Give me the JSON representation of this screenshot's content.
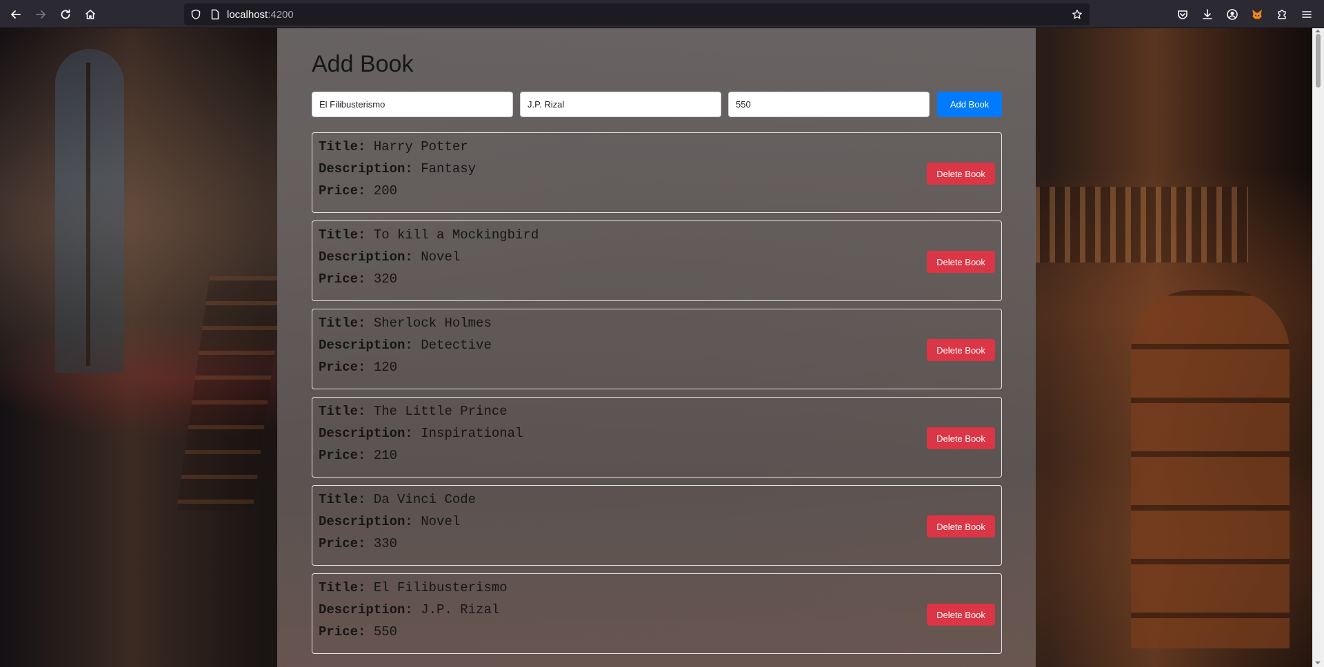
{
  "browser": {
    "url_host": "localhost",
    "url_port": ":4200",
    "icons": [
      "back-icon",
      "forward-icon",
      "reload-icon",
      "home-icon",
      "shield-icon",
      "page-icon",
      "bookmark-star-icon",
      "pocket-icon",
      "downloads-icon",
      "account-icon",
      "metamask-fox-icon",
      "extensions-icon",
      "menu-icon"
    ]
  },
  "page": {
    "title": "Add Book",
    "form": {
      "title_value": "El Filibusterismo",
      "description_value": "J.P. Rizal",
      "price_value": "550",
      "submit_label": "Add Book"
    },
    "labels": {
      "title": "Title:",
      "description": "Description:",
      "price": "Price:"
    },
    "books": [
      {
        "title": "Harry Potter",
        "description": "Fantasy",
        "price": "200",
        "delete_label": "Delete Book"
      },
      {
        "title": "To kill a Mockingbird",
        "description": "Novel",
        "price": "320",
        "delete_label": "Delete Book"
      },
      {
        "title": "Sherlock Holmes",
        "description": "Detective",
        "price": "120",
        "delete_label": "Delete Book"
      },
      {
        "title": "The Little Prince",
        "description": "Inspirational",
        "price": "210",
        "delete_label": "Delete Book"
      },
      {
        "title": "Da Vinci Code",
        "description": "Novel",
        "price": "330",
        "delete_label": "Delete Book"
      },
      {
        "title": "El Filibusterismo",
        "description": "J.P. Rizal",
        "price": "550",
        "delete_label": "Delete Book"
      }
    ]
  },
  "colors": {
    "primary_button": "#007bff",
    "danger_button": "#dc3545",
    "toolbar": "#2b2a33"
  }
}
